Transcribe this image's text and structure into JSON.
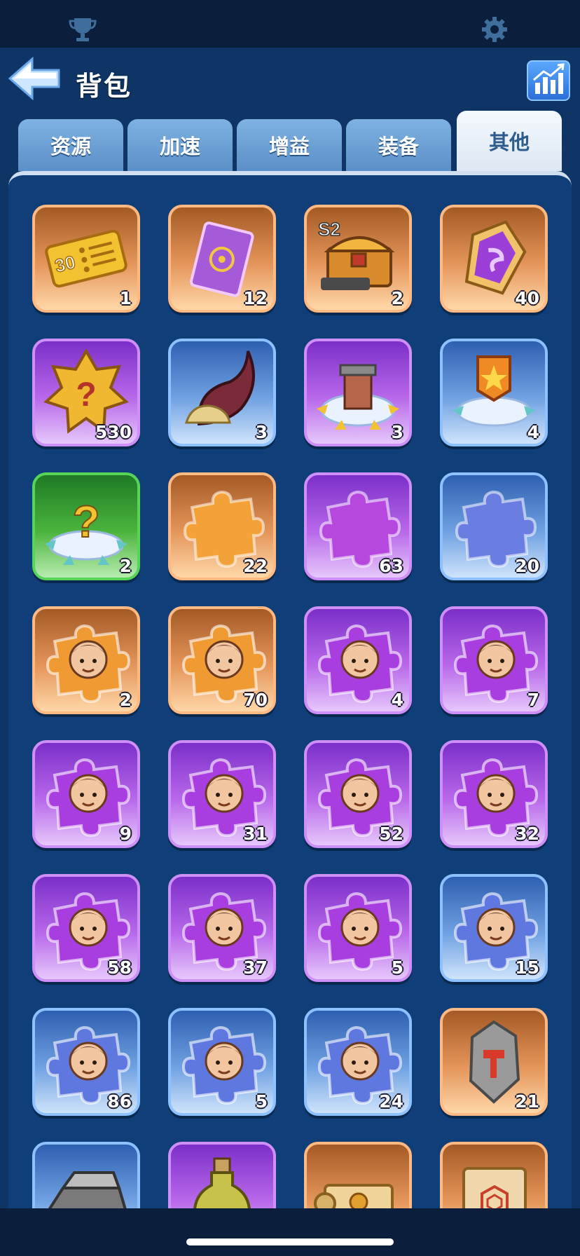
{
  "header": {
    "title": "背包"
  },
  "tabs": [
    {
      "label": "资源",
      "active": false
    },
    {
      "label": "加速",
      "active": false
    },
    {
      "label": "增益",
      "active": false
    },
    {
      "label": "装备",
      "active": false
    },
    {
      "label": "其他",
      "active": true
    }
  ],
  "colors": {
    "background": "#0e3566",
    "tab": "#6b9fd3",
    "tab_active": "#eef4fa",
    "rarity_orange": "#e4955a",
    "rarity_purple": "#b868ea",
    "rarity_blue": "#6fa1e2",
    "rarity_green": "#4bb43d"
  },
  "items": [
    {
      "name": "speedup-ticket-30",
      "icon": "ticket-icon",
      "rarity": "orange",
      "count": "1",
      "badge": "30"
    },
    {
      "name": "card",
      "icon": "card-icon",
      "rarity": "orange",
      "count": "12"
    },
    {
      "name": "s2-treasure-chest",
      "icon": "chest-icon",
      "rarity": "orange",
      "count": "2",
      "badge": "S2"
    },
    {
      "name": "purple-gem",
      "icon": "gem-icon",
      "rarity": "orange",
      "count": "40"
    },
    {
      "name": "mystery-badge",
      "icon": "question-badge-icon",
      "rarity": "purple",
      "count": "530"
    },
    {
      "name": "horn",
      "icon": "horn-icon",
      "rarity": "blue",
      "count": "3"
    },
    {
      "name": "relocate-building",
      "icon": "relocate-tower-icon",
      "rarity": "purple",
      "count": "3"
    },
    {
      "name": "relocate-banner",
      "icon": "relocate-banner-icon",
      "rarity": "blue",
      "count": "4"
    },
    {
      "name": "random-relocate",
      "icon": "relocate-question-icon",
      "rarity": "green",
      "count": "2"
    },
    {
      "name": "puzzle-orange",
      "icon": "puzzle-piece-icon",
      "rarity": "orange",
      "count": "22"
    },
    {
      "name": "puzzle-purple",
      "icon": "puzzle-piece-icon",
      "rarity": "purple",
      "count": "63"
    },
    {
      "name": "puzzle-blue",
      "icon": "puzzle-piece-icon",
      "rarity": "blue",
      "count": "20"
    },
    {
      "name": "hero-fragment-plague-doctor",
      "icon": "hero-fragment-icon",
      "rarity": "orange",
      "count": "2"
    },
    {
      "name": "hero-fragment-silver-hair",
      "icon": "hero-fragment-icon",
      "rarity": "orange",
      "count": "70"
    },
    {
      "name": "hero-fragment-doctor",
      "icon": "hero-fragment-icon",
      "rarity": "purple",
      "count": "4"
    },
    {
      "name": "hero-fragment-desert",
      "icon": "hero-fragment-icon",
      "rarity": "purple",
      "count": "7"
    },
    {
      "name": "hero-fragment-girl",
      "icon": "hero-fragment-icon",
      "rarity": "purple",
      "count": "9"
    },
    {
      "name": "hero-fragment-redhead",
      "icon": "hero-fragment-icon",
      "rarity": "purple",
      "count": "31"
    },
    {
      "name": "hero-fragment-viking",
      "icon": "hero-fragment-icon",
      "rarity": "purple",
      "count": "52"
    },
    {
      "name": "hero-fragment-aviator",
      "icon": "hero-fragment-icon",
      "rarity": "purple",
      "count": "32"
    },
    {
      "name": "hero-fragment-elder",
      "icon": "hero-fragment-icon",
      "rarity": "purple",
      "count": "58"
    },
    {
      "name": "hero-fragment-helmet",
      "icon": "hero-fragment-icon",
      "rarity": "purple",
      "count": "37"
    },
    {
      "name": "hero-fragment-lady",
      "icon": "hero-fragment-icon",
      "rarity": "purple",
      "count": "5"
    },
    {
      "name": "hero-fragment-blonde",
      "icon": "hero-fragment-icon",
      "rarity": "blue",
      "count": "15"
    },
    {
      "name": "hero-fragment-officer",
      "icon": "hero-fragment-icon",
      "rarity": "blue",
      "count": "86"
    },
    {
      "name": "hero-fragment-goggles",
      "icon": "hero-fragment-icon",
      "rarity": "blue",
      "count": "5"
    },
    {
      "name": "hero-fragment-soldier",
      "icon": "hero-fragment-icon",
      "rarity": "blue",
      "count": "24"
    },
    {
      "name": "forge-stone",
      "icon": "hammer-stone-icon",
      "rarity": "orange",
      "count": "21"
    },
    {
      "name": "iron-ingot",
      "icon": "ingot-icon",
      "rarity": "blue",
      "count": ""
    },
    {
      "name": "potion-bottle",
      "icon": "potion-icon",
      "rarity": "purple",
      "count": ""
    },
    {
      "name": "gold-scroll",
      "icon": "scroll-icon",
      "rarity": "orange",
      "count": ""
    },
    {
      "name": "map-scroll",
      "icon": "map-scroll-icon",
      "rarity": "orange",
      "count": ""
    }
  ]
}
